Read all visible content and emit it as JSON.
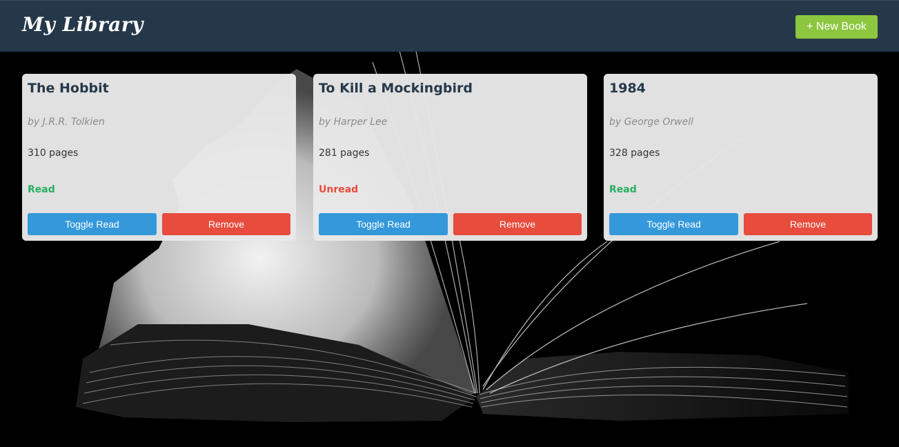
{
  "header": {
    "title": "My Library",
    "new_book_label": "+ New Book"
  },
  "colors": {
    "header_bg": "#253849",
    "new_book_button": "#8dc63f",
    "toggle_button": "#3498db",
    "remove_button": "#e74c3c",
    "status_read": "#27ae60",
    "status_unread": "#e74c3c"
  },
  "books": [
    {
      "title": "The Hobbit",
      "author": "by J.R.R. Tolkien",
      "pages": "310 pages",
      "status": "Read",
      "toggle_label": "Toggle Read",
      "remove_label": "Remove"
    },
    {
      "title": "To Kill a Mockingbird",
      "author": "by Harper Lee",
      "pages": "281 pages",
      "status": "Unread",
      "toggle_label": "Toggle Read",
      "remove_label": "Remove"
    },
    {
      "title": "1984",
      "author": "by George Orwell",
      "pages": "328 pages",
      "status": "Read",
      "toggle_label": "Toggle Read",
      "remove_label": "Remove"
    }
  ]
}
